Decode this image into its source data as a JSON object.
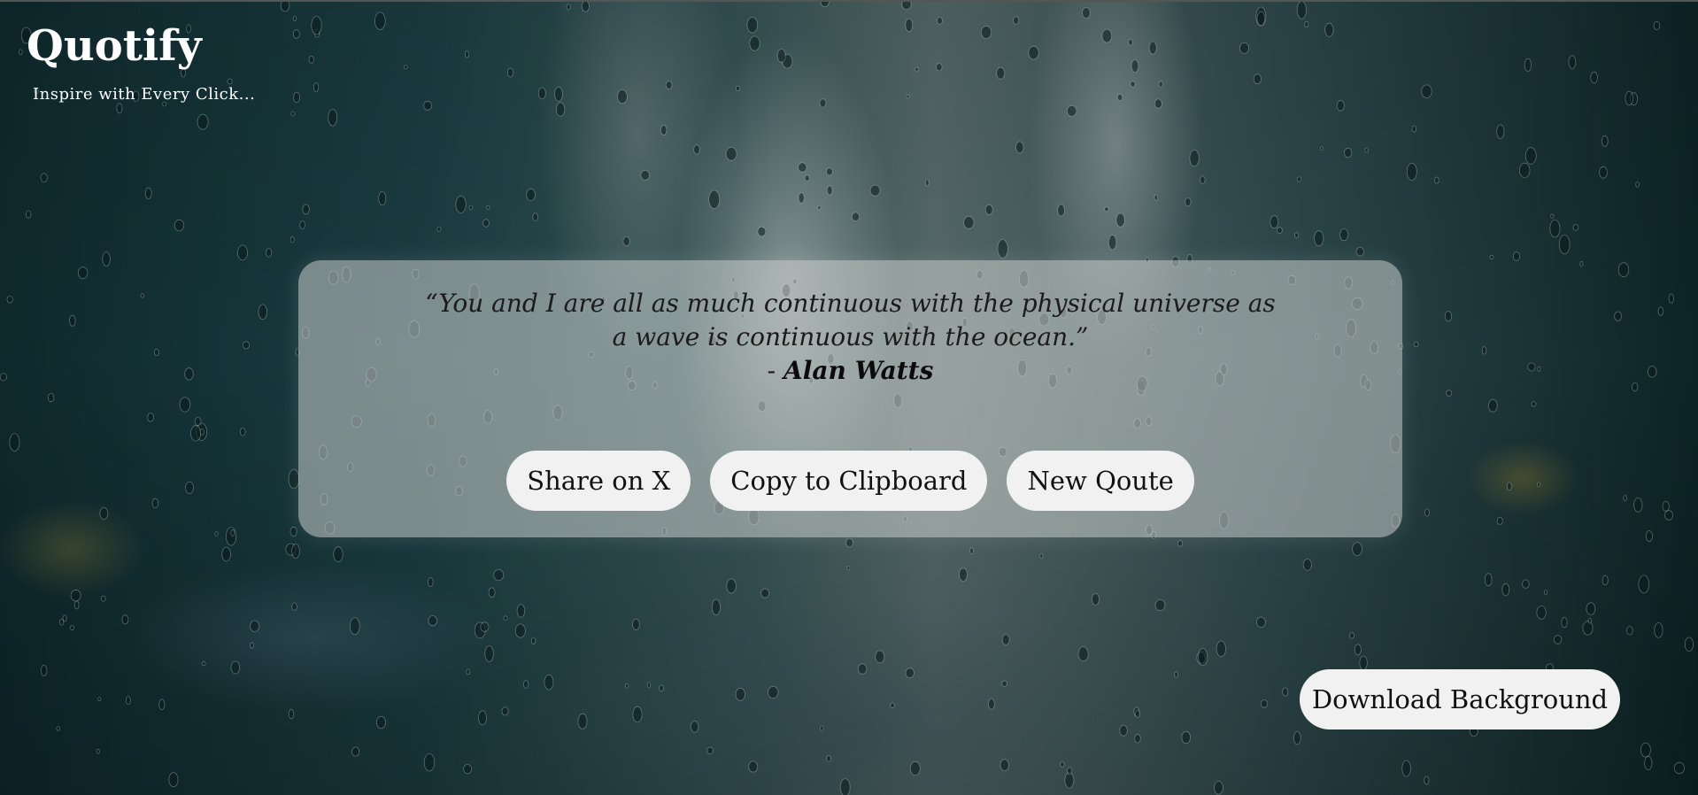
{
  "brand": {
    "title": "Quotify",
    "tagline": "Inspire with Every Click..."
  },
  "quote": {
    "text": "“You and I are all as much continuous with the physical universe as a wave is continuous with the ocean.”",
    "author_prefix": "- ",
    "author": "Alan Watts"
  },
  "actions": {
    "share_label": "Share on X",
    "copy_label": "Copy to Clipboard",
    "new_quote_label": "New Qoute"
  },
  "download": {
    "label": "Download Background"
  },
  "colors": {
    "button_bg": "#f1f1f1",
    "card_bg": "rgba(205,210,208,0.55)",
    "brand_text": "#ffffff"
  }
}
